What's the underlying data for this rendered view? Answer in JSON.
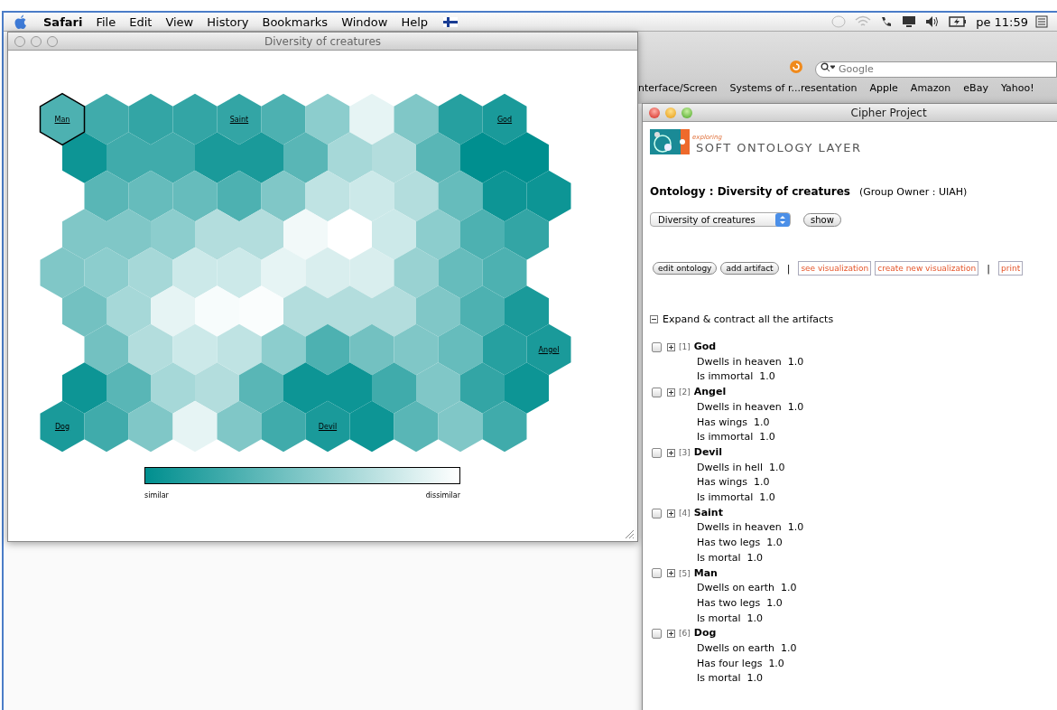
{
  "menu_bar": {
    "app": "Safari",
    "items": [
      "File",
      "Edit",
      "View",
      "History",
      "Bookmarks",
      "Window",
      "Help"
    ],
    "clock": "pe 11:59"
  },
  "map_window": {
    "title": "Diversity of creatures",
    "active": false,
    "map_labels": [
      {
        "text": "Man",
        "selected": true
      },
      {
        "text": "Saint",
        "selected": false
      },
      {
        "text": "God",
        "selected": false
      },
      {
        "text": "Angel",
        "selected": false
      },
      {
        "text": "Dog",
        "selected": false
      },
      {
        "text": "Devil",
        "selected": false
      }
    ],
    "legend": {
      "low": "similar",
      "high": "dissimilar"
    }
  },
  "browser": {
    "search": {
      "placeholder": "Google"
    },
    "bookmarks": [
      "nterface/Screen",
      "Systems of r...resentation",
      "Apple",
      "Amazon",
      "eBay",
      "Yahoo!"
    ]
  },
  "cipher_window": {
    "title": "Cipher Project",
    "active": true,
    "logo": {
      "tagline": "exploring",
      "name": "SOFT ONTOLOGY LAYER"
    },
    "heading": "Ontology : Diversity of creatures",
    "owner": "(Group Owner : UIAH)",
    "ontology_select": {
      "value": "Diversity of creatures"
    },
    "show_button": "show",
    "actions": [
      {
        "kind": "pill",
        "label": "edit ontology"
      },
      {
        "kind": "pill",
        "label": "add artifact"
      },
      {
        "kind": "separator",
        "label": "|"
      },
      {
        "kind": "boxed",
        "label": "see visualization"
      },
      {
        "kind": "boxed",
        "label": "create new visualization"
      },
      {
        "kind": "separator",
        "label": "|"
      },
      {
        "kind": "boxed",
        "label": "print"
      }
    ],
    "expand_all": {
      "label": "Expand & contract all the artifacts",
      "expanded": true
    },
    "artifacts": [
      {
        "index": "[1]",
        "name": "God",
        "checked": false,
        "expanded": false,
        "properties": [
          {
            "name": "Dwells in heaven",
            "value": "1.0"
          },
          {
            "name": "Is immortal",
            "value": "1.0"
          }
        ]
      },
      {
        "index": "[2]",
        "name": "Angel",
        "checked": false,
        "expanded": false,
        "properties": [
          {
            "name": "Dwells in heaven",
            "value": "1.0"
          },
          {
            "name": "Has wings",
            "value": "1.0"
          },
          {
            "name": "Is immortal",
            "value": "1.0"
          }
        ]
      },
      {
        "index": "[3]",
        "name": "Devil",
        "checked": false,
        "expanded": false,
        "properties": [
          {
            "name": "Dwells in hell",
            "value": "1.0"
          },
          {
            "name": "Has wings",
            "value": "1.0"
          },
          {
            "name": "Is immortal",
            "value": "1.0"
          }
        ]
      },
      {
        "index": "[4]",
        "name": "Saint",
        "checked": false,
        "expanded": false,
        "properties": [
          {
            "name": "Dwells in heaven",
            "value": "1.0"
          },
          {
            "name": "Has two legs",
            "value": "1.0"
          },
          {
            "name": "Is mortal",
            "value": "1.0"
          }
        ]
      },
      {
        "index": "[5]",
        "name": "Man",
        "checked": false,
        "expanded": false,
        "properties": [
          {
            "name": "Dwells on earth",
            "value": "1.0"
          },
          {
            "name": "Has two legs",
            "value": "1.0"
          },
          {
            "name": "Is mortal",
            "value": "1.0"
          }
        ]
      },
      {
        "index": "[6]",
        "name": "Dog",
        "checked": false,
        "expanded": false,
        "properties": [
          {
            "name": "Dwells on earth",
            "value": "1.0"
          },
          {
            "name": "Has four legs",
            "value": "1.0"
          },
          {
            "name": "Is mortal",
            "value": "1.0"
          }
        ]
      }
    ]
  }
}
